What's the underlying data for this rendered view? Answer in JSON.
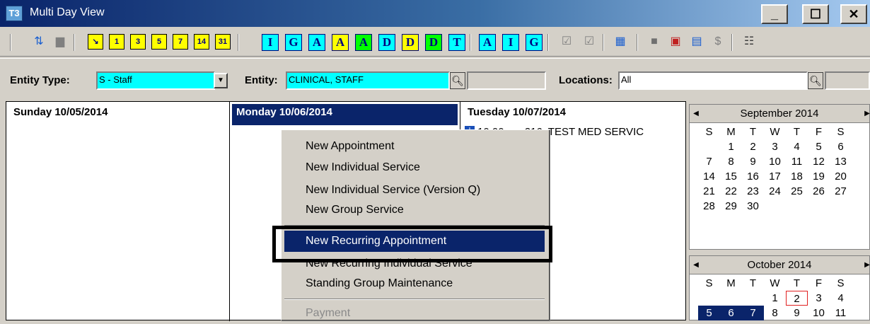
{
  "window": {
    "title": "Multi Day View",
    "icon_label": "T3",
    "buttons": {
      "minimize": "_",
      "maximize": "☐",
      "close": "✕"
    }
  },
  "toolbar": {
    "numbers": [
      "1",
      "3",
      "5",
      "7",
      "14",
      "31"
    ],
    "letters": [
      "I",
      "G",
      "A",
      "A",
      "A",
      "D",
      "D",
      "D",
      "T",
      "A",
      "I",
      "G"
    ]
  },
  "filters": {
    "entity_type_label": "Entity Type:",
    "entity_type_value": "S - Staff",
    "entity_label": "Entity:",
    "entity_value": "CLINICAL, STAFF",
    "locations_label": "Locations:",
    "locations_value": "All"
  },
  "days": [
    {
      "header": "Sunday 10/05/2014",
      "selected": false
    },
    {
      "header": "Monday 10/06/2014",
      "selected": true
    },
    {
      "header": "Tuesday 10/07/2014",
      "selected": false
    }
  ],
  "appointment": {
    "badge": "I",
    "text": "10:00am: 216, TEST MED SERVIC"
  },
  "calendars": [
    {
      "month": "September 2014",
      "weekdays": [
        "S",
        "M",
        "T",
        "W",
        "T",
        "F",
        "S"
      ],
      "days": [
        "",
        "1",
        "2",
        "3",
        "4",
        "5",
        "6",
        "7",
        "8",
        "9",
        "10",
        "11",
        "12",
        "13",
        "14",
        "15",
        "16",
        "17",
        "18",
        "19",
        "20",
        "21",
        "22",
        "23",
        "24",
        "25",
        "26",
        "27",
        "28",
        "29",
        "30",
        "",
        "",
        "",
        ""
      ]
    },
    {
      "month": "October 2014",
      "weekdays": [
        "S",
        "M",
        "T",
        "W",
        "T",
        "F",
        "S"
      ],
      "days": [
        "",
        "",
        "",
        "1",
        "2",
        "3",
        "4",
        "5",
        "6",
        "7",
        "8",
        "9",
        "10",
        "11"
      ],
      "today": "2",
      "selected": [
        "5",
        "6",
        "7"
      ]
    }
  ],
  "context_menu": {
    "items": [
      {
        "label": "New Appointment"
      },
      {
        "label": "New Individual Service"
      },
      {
        "label": "New Individual Service (Version Q)"
      },
      {
        "label": "New Group Service"
      },
      {
        "label": "New Recurring Appointment",
        "highlighted": true
      },
      {
        "label": "New Recurring Individual Service"
      },
      {
        "label": "Standing Group Maintenance"
      },
      {
        "label": "Payment",
        "disabled": true
      }
    ]
  }
}
